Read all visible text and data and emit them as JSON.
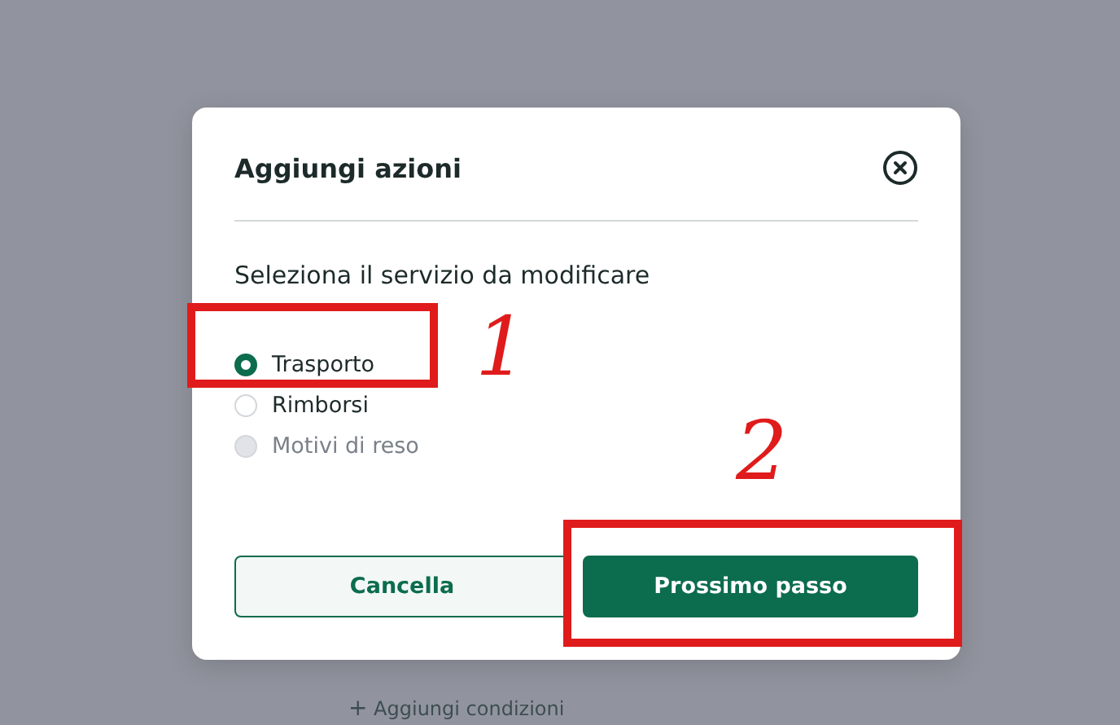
{
  "background": {
    "link": {
      "icon": "+",
      "label": "Aggiungi condizioni"
    }
  },
  "dialog": {
    "title": "Aggiungi azioni",
    "subtitle": "Seleziona il servizio da modificare",
    "options": [
      {
        "label": "Trasporto",
        "selected": true,
        "disabled": false
      },
      {
        "label": "Rimborsi",
        "selected": false,
        "disabled": false
      },
      {
        "label": "Motivi di reso",
        "selected": false,
        "disabled": true
      }
    ],
    "buttons": [
      {
        "label": "Cancella",
        "kind": "secondary"
      },
      {
        "label": "Prossimo passo",
        "kind": "primary"
      }
    ]
  },
  "annotations": [
    {
      "label": "1"
    },
    {
      "label": "2"
    }
  ]
}
